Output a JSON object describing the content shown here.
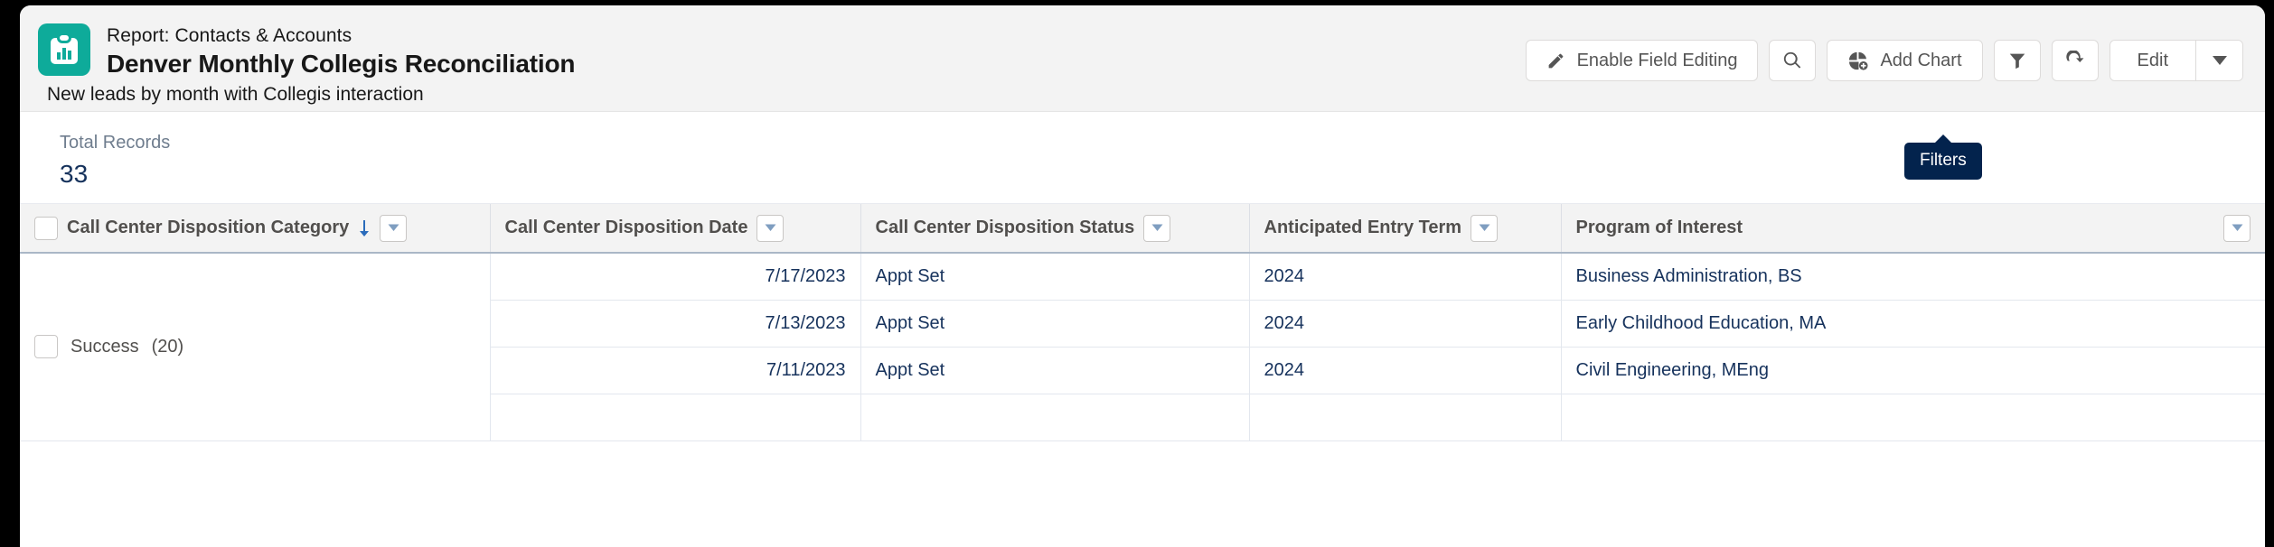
{
  "header": {
    "icon": "report-clipboard-chart-icon",
    "icon_color": "#0eab9a",
    "eyebrow": "Report: Contacts & Accounts",
    "title": "Denver Monthly Collegis Reconciliation",
    "description": "New leads by month with Collegis interaction"
  },
  "toolbar": {
    "enable_field_editing_label": "Enable Field Editing",
    "search_icon": "search-icon",
    "add_chart_label": "Add Chart",
    "add_chart_icon": "chart-add-icon",
    "filters_icon": "funnel-icon",
    "refresh_icon": "refresh-icon",
    "edit_label": "Edit",
    "edit_caret_icon": "chevron-down-icon"
  },
  "tooltip": {
    "text": "Filters",
    "background": "#03234d"
  },
  "summary": {
    "label": "Total Records",
    "value": "33",
    "value_color": "#16325c"
  },
  "table": {
    "columns": [
      {
        "label": "Call Center Disposition Category",
        "sorted": true,
        "sort_direction": "down",
        "has_checkbox": true,
        "has_menu": true
      },
      {
        "label": "Call Center Disposition Date",
        "sorted": false,
        "has_checkbox": false,
        "has_menu": true
      },
      {
        "label": "Call Center Disposition Status",
        "sorted": false,
        "has_checkbox": false,
        "has_menu": true
      },
      {
        "label": "Anticipated Entry Term",
        "sorted": false,
        "has_checkbox": false,
        "has_menu": true
      },
      {
        "label": "Program of Interest",
        "sorted": false,
        "has_checkbox": false,
        "has_menu": true
      }
    ],
    "group": {
      "label": "Success",
      "count": "(20)",
      "has_checkbox": true
    },
    "rows": [
      {
        "date": "7/17/2023",
        "status": "Appt Set",
        "term": "2024",
        "program": "Business Administration, BS"
      },
      {
        "date": "7/13/2023",
        "status": "Appt Set",
        "term": "2024",
        "program": "Early Childhood Education, MA"
      },
      {
        "date": "7/11/2023",
        "status": "Appt Set",
        "term": "2024",
        "program": "Civil Engineering, MEng"
      }
    ]
  }
}
